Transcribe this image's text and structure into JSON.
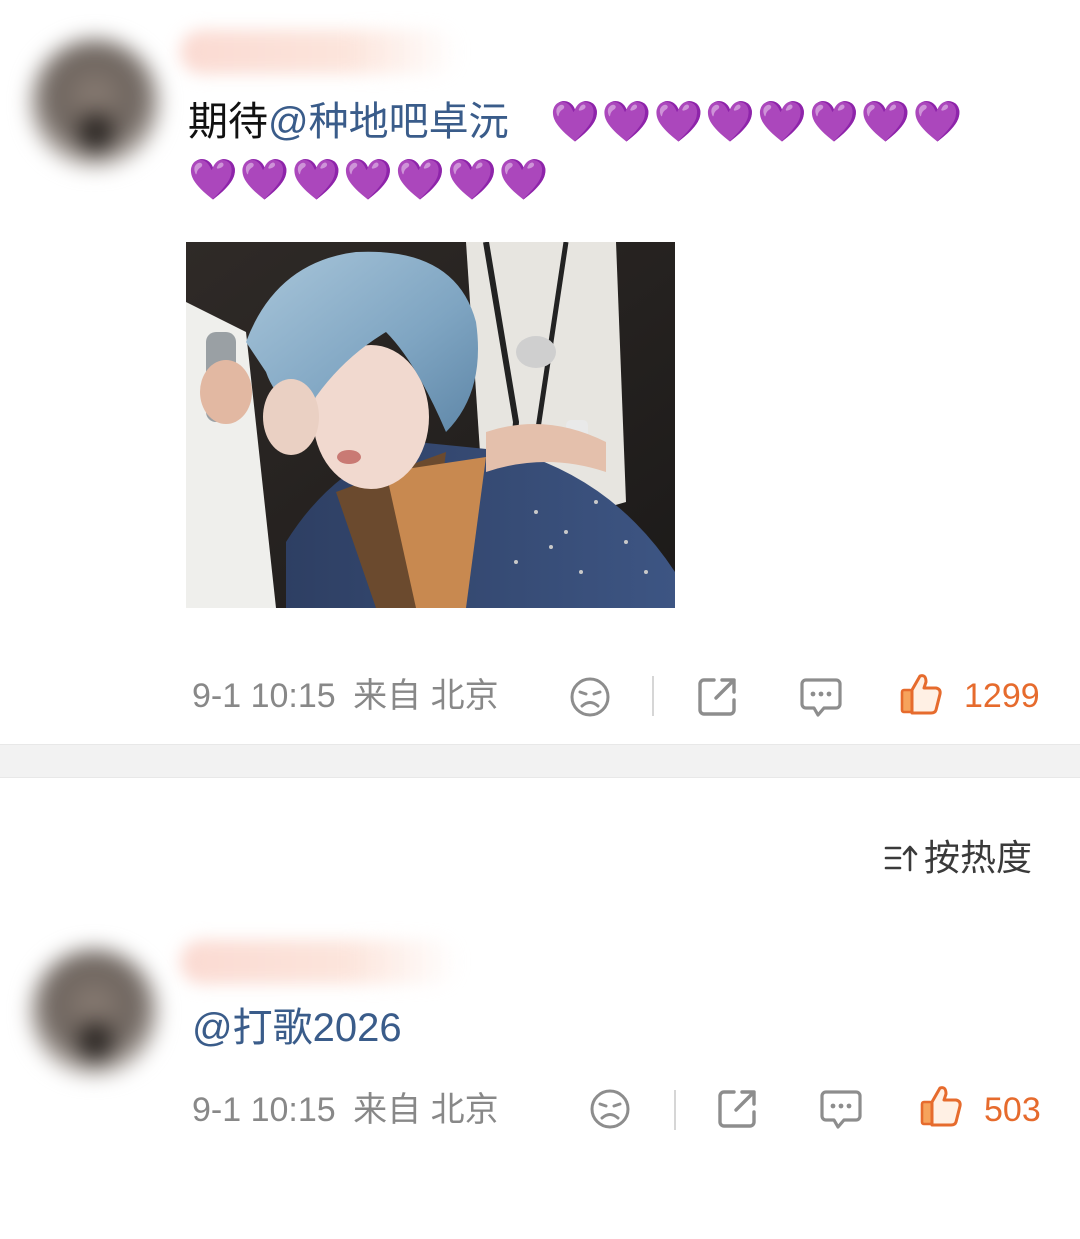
{
  "post": {
    "text_prefix": "期待",
    "mention": "@种地吧卓沅",
    "hearts": "💜💜💜💜💜💜💜💜💜💜💜💜💜💜💜",
    "time": "9-1 10:15",
    "source": "来自 北京",
    "likes": "1299"
  },
  "sort": {
    "label": "按热度"
  },
  "comment": {
    "mention": "@打歌2026",
    "time": "9-1 10:15",
    "source": "来自 北京",
    "likes": "503"
  },
  "colors": {
    "mention": "#3a5c8a",
    "heart": "#9b3fd4",
    "like": "#e66b2d"
  }
}
